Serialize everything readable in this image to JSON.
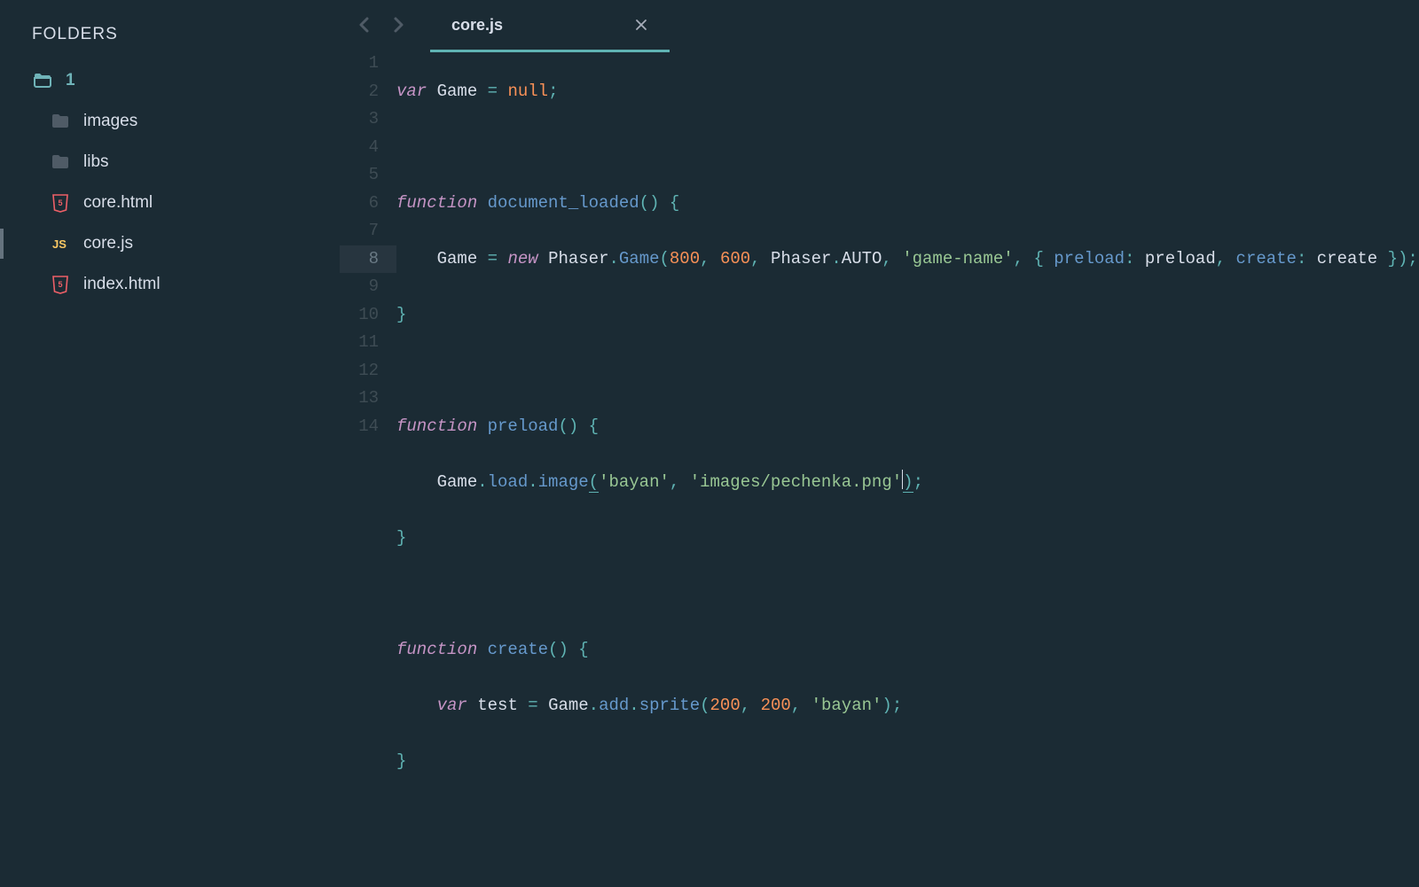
{
  "sidebar": {
    "heading": "FOLDERS",
    "root": {
      "label": "1"
    },
    "items": [
      {
        "name": "images",
        "kind": "folder"
      },
      {
        "name": "libs",
        "kind": "folder"
      },
      {
        "name": "core.html",
        "kind": "html"
      },
      {
        "name": "core.js",
        "kind": "js",
        "active": true
      },
      {
        "name": "index.html",
        "kind": "html"
      }
    ]
  },
  "tabs": [
    {
      "label": "core.js",
      "active": true
    }
  ],
  "editor": {
    "active_line": 8,
    "line_count": 14,
    "code": {
      "l1": {
        "kw": "var",
        "id": "Game",
        "op1": " = ",
        "null": "null",
        "op2": ";"
      },
      "l3": {
        "kw": "function",
        "fn": "document_loaded",
        "lp": "(",
        "rp": ")",
        "lb": " {"
      },
      "l4": {
        "indent": "    ",
        "assign_id": "Game",
        "assign_op": " = ",
        "new": "new",
        "cls": "Phaser",
        "dot1": ".",
        "m_game": "Game",
        "lp": "(",
        "n1": "800",
        "c1": ", ",
        "n2": "600",
        "c2": ", ",
        "cls2": "Phaser",
        "dot2": ".",
        "auto": "AUTO",
        "c3": ", ",
        "s1": "'game-name'",
        "c4": ", ",
        "ob": "{ ",
        "k1": "preload",
        "col1": ": ",
        "v1": "preload",
        "c5": ", ",
        "k2": "create",
        "col2": ": ",
        "v2": "create",
        "cb": " }",
        "rp": ")",
        "sc": ";"
      },
      "l5": {
        "rb": "}"
      },
      "l7": {
        "kw": "function",
        "fn": "preload",
        "lp": "(",
        "rp": ")",
        "lb": " {"
      },
      "l8": {
        "indent": "    ",
        "obj": "Game",
        "d1": ".",
        "p1": "load",
        "d2": ".",
        "m": "image",
        "lp": "(",
        "s1": "'bayan'",
        "c1": ", ",
        "s2": "'images/pechenka.png'",
        "rp": ")",
        "sc": ";"
      },
      "l9": {
        "rb": "}"
      },
      "l11": {
        "kw": "function",
        "fn": "create",
        "lp": "(",
        "rp": ")",
        "lb": " {"
      },
      "l12": {
        "indent": "    ",
        "kw": "var",
        "id": "test",
        "op": " = ",
        "obj": "Game",
        "d1": ".",
        "p1": "add",
        "d2": ".",
        "m": "sprite",
        "lp": "(",
        "n1": "200",
        "c1": ", ",
        "n2": "200",
        "c2": ", ",
        "s1": "'bayan'",
        "rp": ")",
        "sc": ";"
      },
      "l13": {
        "rb": "}"
      }
    }
  }
}
